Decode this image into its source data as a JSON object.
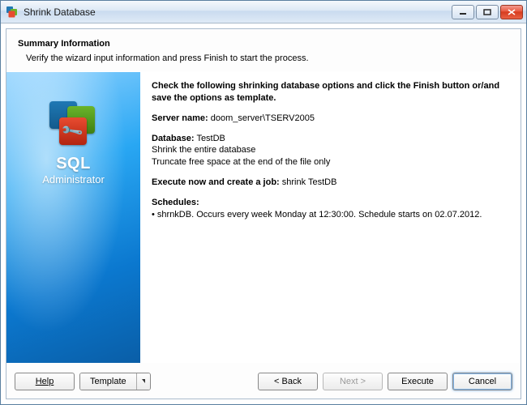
{
  "window": {
    "title": "Shrink Database"
  },
  "header": {
    "title": "Summary Information",
    "subtitle": "Verify the wizard input information and press Finish to start the process."
  },
  "sidebar": {
    "title": "SQL",
    "subtitle": "Administrator"
  },
  "summary": {
    "intro": "Check the following shrinking database options and click the Finish button or/and save the options as template.",
    "server_label": "Server name:",
    "server_value": "doom_server\\TSERV2005",
    "database_label": "Database:",
    "database_value": "TestDB",
    "db_line1": "Shrink the entire database",
    "db_line2": "Truncate free space at the end of the file only",
    "execute_label": "Execute now and create a job:",
    "execute_value": "shrink TestDB",
    "schedules_label": "Schedules:",
    "schedule_item": "• shrnkDB. Occurs every week Monday at 12:30:00. Schedule starts on 02.07.2012."
  },
  "buttons": {
    "help": "Help",
    "template": "Template",
    "back": "< Back",
    "next": "Next >",
    "execute": "Execute",
    "cancel": "Cancel"
  }
}
